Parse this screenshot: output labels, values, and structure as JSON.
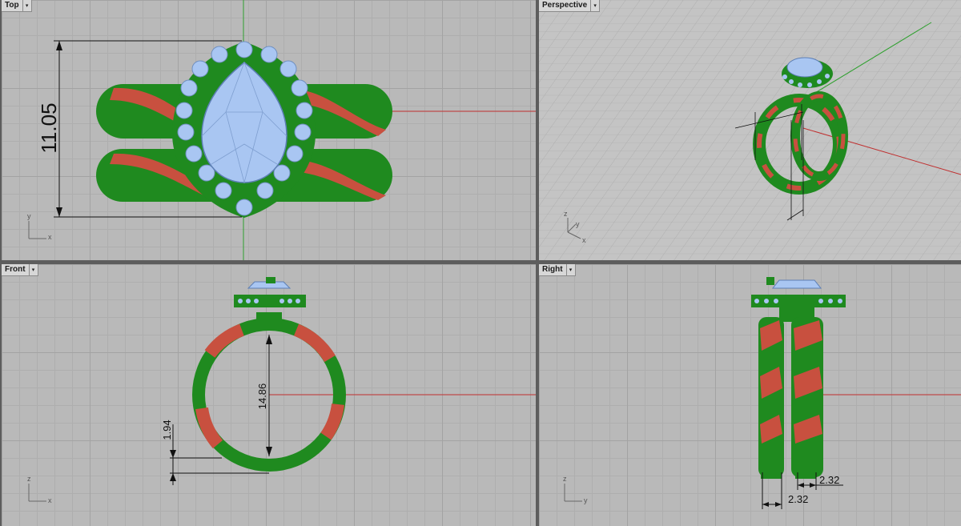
{
  "viewports": {
    "top": {
      "title": "Top",
      "dropdown": "▾",
      "dimension": "11.05",
      "axis_x": "x",
      "axis_y": "y"
    },
    "perspective": {
      "title": "Perspective",
      "dropdown": "▾",
      "axis_x": "x",
      "axis_y": "y",
      "axis_z": "z"
    },
    "front": {
      "title": "Front",
      "dropdown": "▾",
      "dim_inner": "14.86",
      "dim_band": "1.94",
      "axis_x": "x",
      "axis_z": "z"
    },
    "right": {
      "title": "Right",
      "dropdown": "▾",
      "dim_top": "2.32",
      "dim_bottom": "2.32",
      "axis_y": "y",
      "axis_z": "z"
    }
  },
  "colors": {
    "band_green": "#1f8a1f",
    "band_red": "#c8503f",
    "stone_blue": "#a9c6f2",
    "grid_bg": "#b9b9b9"
  }
}
